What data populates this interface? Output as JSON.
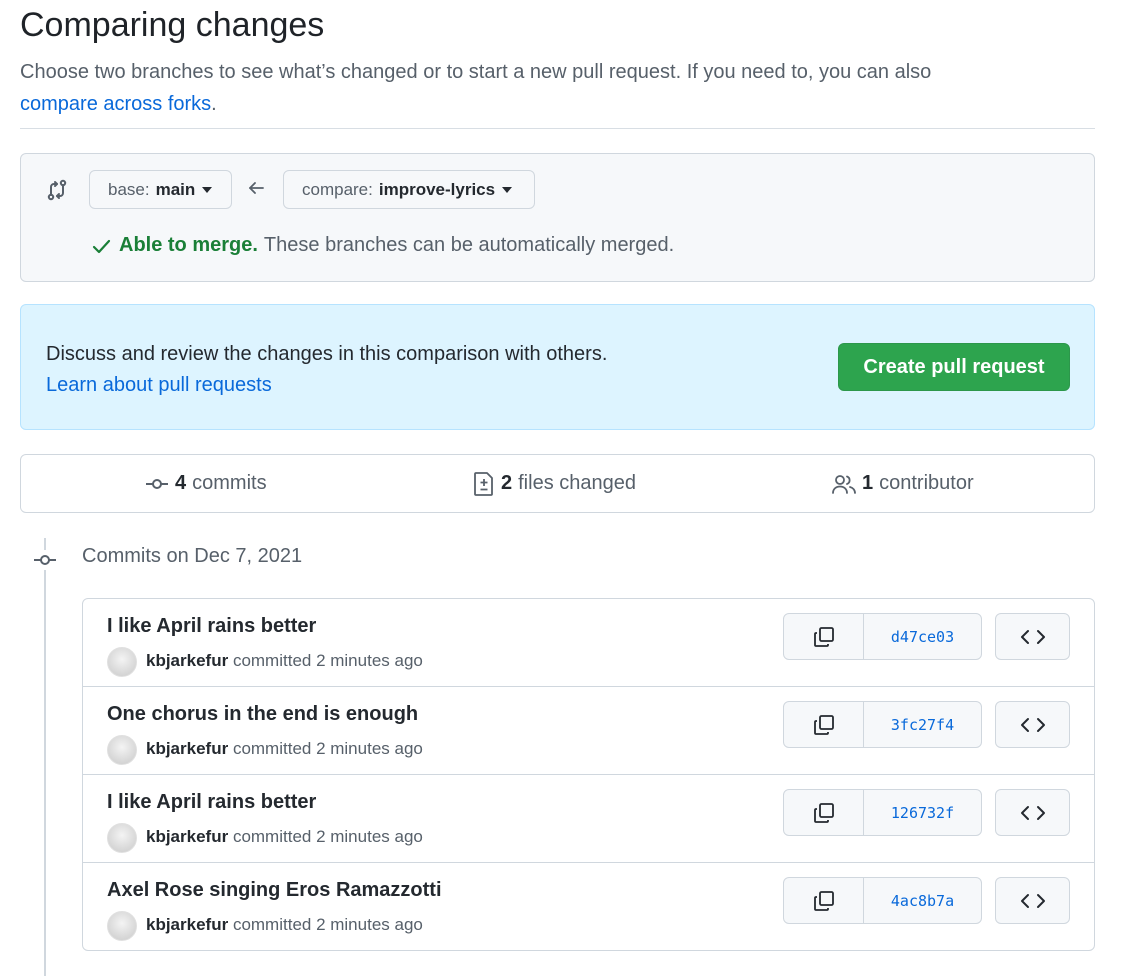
{
  "header": {
    "title": "Comparing changes",
    "intro_text": "Choose two branches to see what’s changed or to start a new pull request. If you need to, you can also",
    "intro_link": "compare across forks",
    "intro_end": "."
  },
  "range": {
    "base_label": "base:",
    "base_value": "main",
    "compare_label": "compare:",
    "compare_value": "improve-lyrics",
    "merge_ok": "Able to merge.",
    "merge_text": "These branches can be automatically merged."
  },
  "pr_prompt": {
    "text": "Discuss and review the changes in this comparison with others.",
    "link": "Learn about pull requests",
    "button": "Create pull request"
  },
  "summary": {
    "commits_count": "4",
    "commits_label": "commits",
    "files_count": "2",
    "files_label": "files changed",
    "contributors_count": "1",
    "contributors_label": "contributor"
  },
  "commits_heading": "Commits on Dec 7, 2021",
  "commits": [
    {
      "title": "I like April rains better",
      "author": "kbjarkefur",
      "meta": "committed 2 minutes ago",
      "sha": "d47ce03"
    },
    {
      "title": "One chorus in the end is enough",
      "author": "kbjarkefur",
      "meta": "committed 2 minutes ago",
      "sha": "3fc27f4"
    },
    {
      "title": "I like April rains better",
      "author": "kbjarkefur",
      "meta": "committed 2 minutes ago",
      "sha": "126732f"
    },
    {
      "title": "Axel Rose singing Eros Ramazzotti",
      "author": "kbjarkefur",
      "meta": "committed 2 minutes ago",
      "sha": "4ac8b7a"
    }
  ],
  "colors": {
    "link": "#0969da",
    "success": "#1a7f37",
    "primary_button": "#2da44e",
    "info_background": "#ddf4ff"
  }
}
